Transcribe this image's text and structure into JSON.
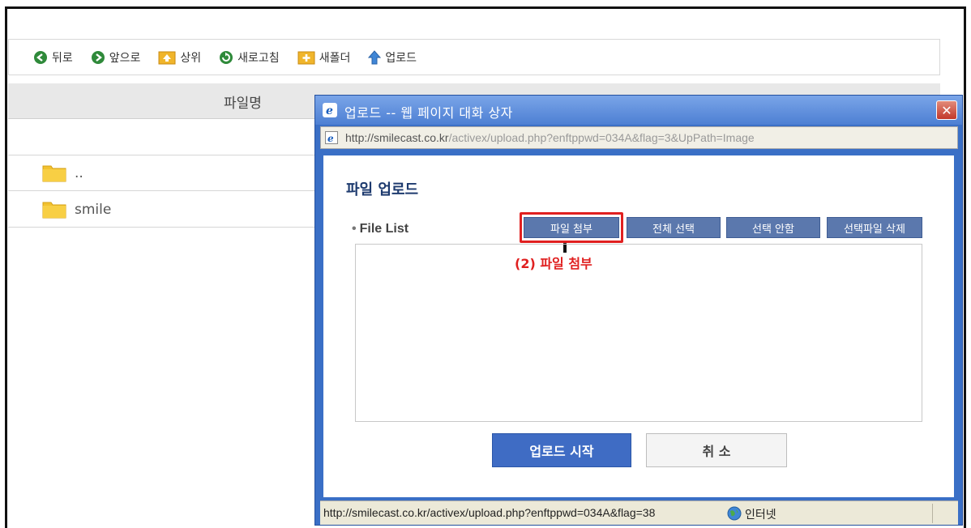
{
  "toolbar": {
    "back": "뒤로",
    "forward": "앞으로",
    "up": "상위",
    "refresh": "새로고침",
    "new_folder": "새폴더",
    "upload": "업로드"
  },
  "list": {
    "col_name": "파일명",
    "rows": [
      {
        "name": ".."
      },
      {
        "name": "smile"
      }
    ]
  },
  "dialog": {
    "title": "업로드 -- 웹 페이지 대화 상자",
    "url_host": "http://smilecast.co.kr",
    "url_path": "/activex/upload.php?enftppwd=034A&flag=3&UpPath=Image",
    "heading": "파일 업로드",
    "file_list_label": "File List",
    "buttons": {
      "attach": "파일 첨부",
      "select_all": "전체 선택",
      "deselect": "선택 안함",
      "delete_selected": "선택파일 삭제"
    },
    "callout": "(2) 파일 첨부",
    "start": "업로드 시작",
    "cancel": "취 소",
    "status_url": "http://smilecast.co.kr/activex/upload.php?enftppwd=034A&flag=38",
    "status_zone": "인터넷"
  },
  "colors": {
    "dialog_border": "#3a6fc6",
    "action_button": "#5b78ad",
    "start_button": "#3f6cc4",
    "highlight": "#e02020"
  }
}
